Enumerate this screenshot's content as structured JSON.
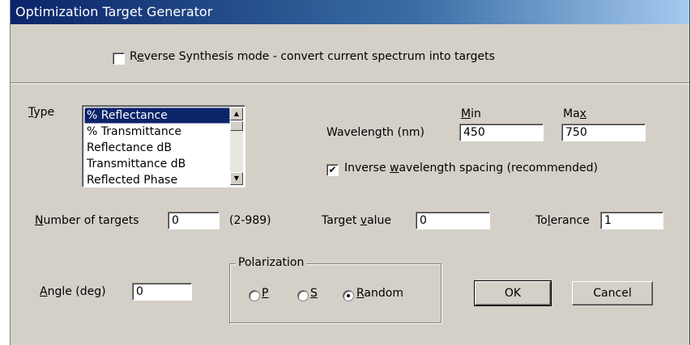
{
  "window": {
    "title": "Optimization Target Generator"
  },
  "reverse_synthesis": {
    "label_pre": "R",
    "label_ul": "e",
    "label_post": "verse Synthesis mode - convert current spectrum into targets",
    "checked": false
  },
  "type": {
    "label_ul": "T",
    "label_post": "ype",
    "options": [
      "% Reflectance",
      "% Transmittance",
      "Reflectance dB",
      "Transmittance dB",
      "Reflected Phase"
    ],
    "selected": "% Reflectance"
  },
  "wavelength": {
    "label": "Wavelength (nm)",
    "min_label_ul": "M",
    "min_label_post": "in",
    "max_label_pre": "Ma",
    "max_label_ul": "x",
    "min_value": "450",
    "max_value": "750"
  },
  "inverse_spacing": {
    "label_pre": "Inverse ",
    "label_ul": "w",
    "label_post": "avelength spacing (recommended)",
    "checked": true,
    "check_glyph": "✔"
  },
  "targets": {
    "number_label_ul": "N",
    "number_label_post": "umber of targets",
    "number_value": "0",
    "range_hint": "(2-989)",
    "value_label_pre": "Target ",
    "value_label_ul": "v",
    "value_label_post": "alue",
    "target_value": "0",
    "tolerance_label_pre": "To",
    "tolerance_label_ul": "l",
    "tolerance_label_post": "erance",
    "tolerance_value": "1"
  },
  "angle": {
    "label_ul": "A",
    "label_post": "ngle (deg)",
    "value": "0"
  },
  "polarization": {
    "label": "Polarization",
    "options": [
      {
        "pre": "",
        "ul": "P",
        "post": "",
        "selected": false
      },
      {
        "pre": "",
        "ul": "S",
        "post": "",
        "selected": false
      },
      {
        "pre": "",
        "ul": "R",
        "post": "andom",
        "selected": true
      }
    ]
  },
  "buttons": {
    "ok": "OK",
    "cancel": "Cancel"
  },
  "scroll_glyphs": {
    "up": "▲",
    "down": "▼"
  }
}
